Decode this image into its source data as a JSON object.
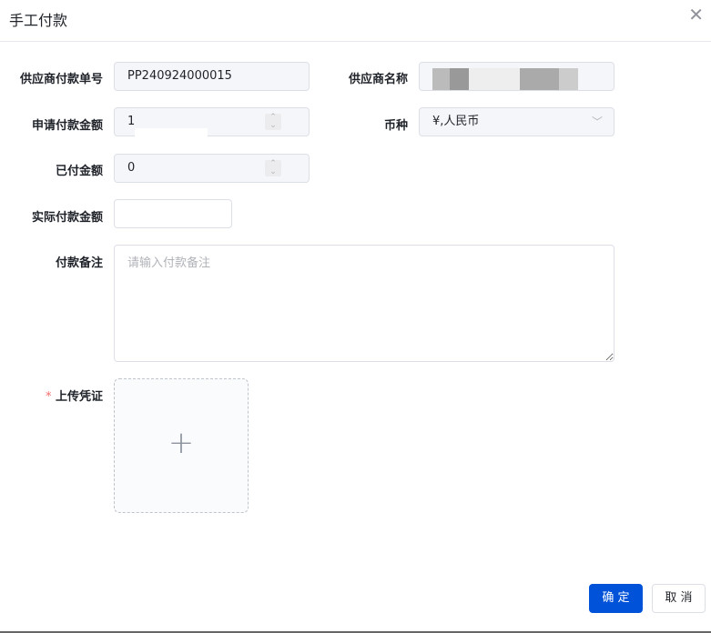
{
  "dialog": {
    "title": "手工付款",
    "close_icon": "close-icon"
  },
  "form": {
    "payment_no": {
      "label": "供应商付款单号",
      "value": "PP240924000015"
    },
    "supplier_name": {
      "label": "供应商名称",
      "value": ""
    },
    "requested_amount": {
      "label": "申请付款金额",
      "value": "1"
    },
    "currency": {
      "label": "币种",
      "value": "¥,人民币"
    },
    "paid_amount": {
      "label": "已付金额",
      "value": "0"
    },
    "actual_amount": {
      "label": "实际付款金额",
      "value": ""
    },
    "remark": {
      "label": "付款备注",
      "placeholder": "请输入付款备注"
    },
    "voucher": {
      "label": "上传凭证",
      "required_mark": "*"
    }
  },
  "footer": {
    "confirm": "确 定",
    "cancel": "取 消"
  },
  "colors": {
    "primary": "#0052d9",
    "required": "#f56c6c"
  }
}
